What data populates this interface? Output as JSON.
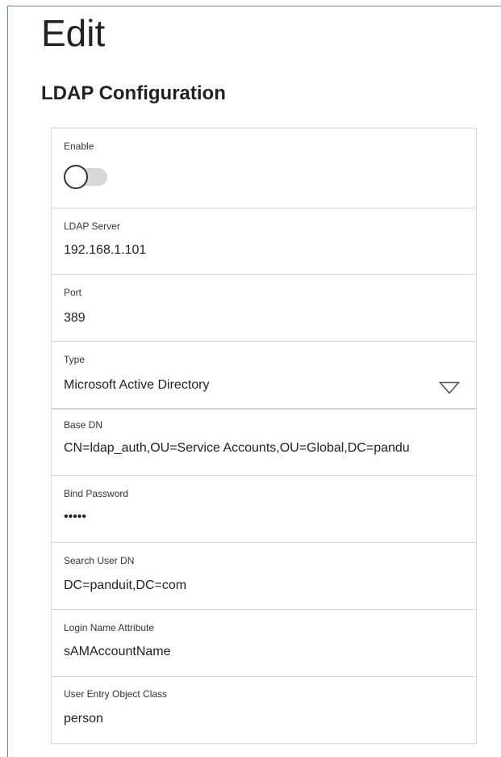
{
  "page": {
    "title": "Edit",
    "section_title": "LDAP Configuration"
  },
  "form": {
    "enable": {
      "label": "Enable",
      "state": "off"
    },
    "ldap_server": {
      "label": "LDAP Server",
      "value": "192.168.1.101"
    },
    "port": {
      "label": "Port",
      "value": "389"
    },
    "type": {
      "label": "Type",
      "value": "Microsoft Active Directory",
      "icon": "chevron-down-icon"
    },
    "base_dn": {
      "label": "Base DN",
      "value": "CN=ldap_auth,OU=Service Accounts,OU=Global,DC=pandu"
    },
    "bind_password": {
      "label": "Bind Password",
      "value": "•••••"
    },
    "search_user_dn": {
      "label": "Search User DN",
      "value": "DC=panduit,DC=com"
    },
    "login_name_attribute": {
      "label": "Login Name Attribute",
      "value": "sAMAccountName"
    },
    "user_entry_object_class": {
      "label": "User Entry Object Class",
      "value": "person"
    }
  },
  "colors": {
    "frame_border": "#4a90d9",
    "field_border": "#d6d6d6",
    "toggle_track": "#d8d8d8"
  }
}
